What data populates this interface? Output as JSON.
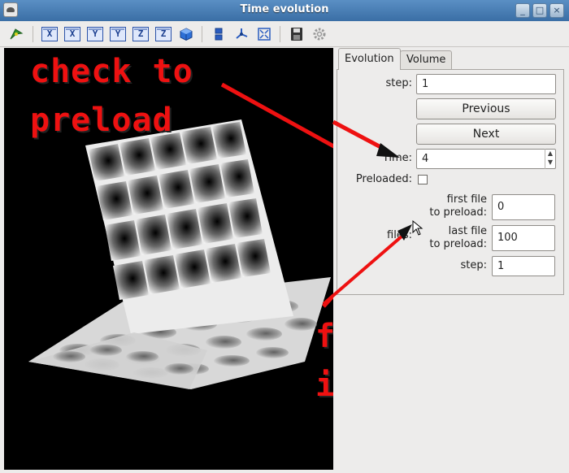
{
  "window": {
    "title": "Time evolution",
    "controls": [
      "_",
      "□",
      "×"
    ]
  },
  "toolbar": {
    "axis_buttons": [
      "X",
      "X",
      "Y",
      "Y",
      "Z",
      "Z"
    ]
  },
  "annotations": {
    "check_line1": "check to",
    "check_line2": "preload",
    "file_line1": "file",
    "file_line2": "indices",
    "color": "#ee1111"
  },
  "tabs": [
    "Evolution",
    "Volume"
  ],
  "evolution": {
    "step_label": "step:",
    "step_value": "1",
    "previous_label": "Previous",
    "next_label": "Next",
    "time_label": "Time:",
    "time_value": "4",
    "preloaded_label": "Preloaded:",
    "preloaded_checked": false,
    "files_label": "files:",
    "first_file_line1": "first file",
    "first_file_line2": "to preload:",
    "first_file_value": "0",
    "last_file_line1": "last file",
    "last_file_line2": "to preload:",
    "last_file_value": "100",
    "files_step_label": "step:",
    "files_step_value": "1"
  }
}
